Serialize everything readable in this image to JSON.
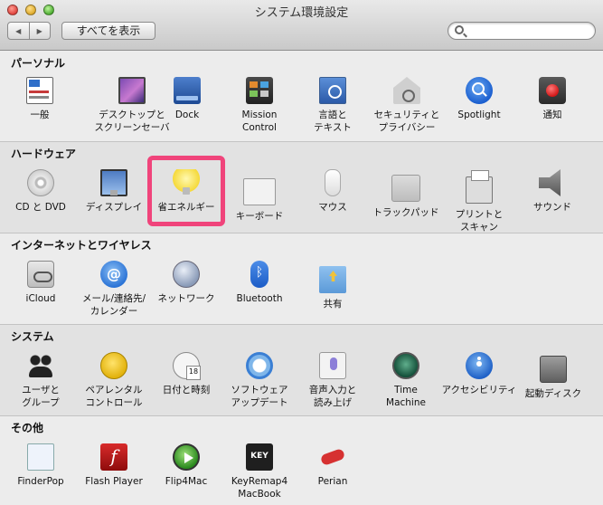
{
  "window": {
    "title": "システム環境設定"
  },
  "toolbar": {
    "back_glyph": "◀",
    "forward_glyph": "▶",
    "show_all_label": "すべてを表示",
    "search_placeholder": ""
  },
  "sections": {
    "personal": {
      "title": "パーソナル",
      "items": [
        {
          "label": "一般"
        },
        {
          "label": "デスクトップと\nスクリーンセーバ"
        },
        {
          "label": "Dock"
        },
        {
          "label": "Mission\nControl"
        },
        {
          "label": "言語と\nテキスト"
        },
        {
          "label": "セキュリティと\nプライバシー"
        },
        {
          "label": "Spotlight"
        },
        {
          "label": "通知"
        }
      ]
    },
    "hardware": {
      "title": "ハードウェア",
      "items": [
        {
          "label": "CD と DVD"
        },
        {
          "label": "ディスプレイ"
        },
        {
          "label": "省エネルギー"
        },
        {
          "label": "キーボード"
        },
        {
          "label": "マウス"
        },
        {
          "label": "トラックパッド"
        },
        {
          "label": "プリントと\nスキャン"
        },
        {
          "label": "サウンド"
        }
      ]
    },
    "internet": {
      "title": "インターネットとワイヤレス",
      "items": [
        {
          "label": "iCloud"
        },
        {
          "label": "メール/連絡先/\nカレンダー"
        },
        {
          "label": "ネットワーク"
        },
        {
          "label": "Bluetooth"
        },
        {
          "label": "共有"
        }
      ]
    },
    "system": {
      "title": "システム",
      "items": [
        {
          "label": "ユーザと\nグループ"
        },
        {
          "label": "ペアレンタル\nコントロール"
        },
        {
          "label": "日付と時刻"
        },
        {
          "label": "ソフトウェア\nアップデート"
        },
        {
          "label": "音声入力と\n読み上げ"
        },
        {
          "label": "Time\nMachine"
        },
        {
          "label": "アクセシビリティ"
        },
        {
          "label": "起動ディスク"
        }
      ]
    },
    "other": {
      "title": "その他",
      "items": [
        {
          "label": "FinderPop"
        },
        {
          "label": "Flash Player"
        },
        {
          "label": "Flip4Mac"
        },
        {
          "label": "KeyRemap4\nMacBook"
        },
        {
          "label": "Perian"
        }
      ]
    }
  },
  "highlight_color": "#f0447b"
}
